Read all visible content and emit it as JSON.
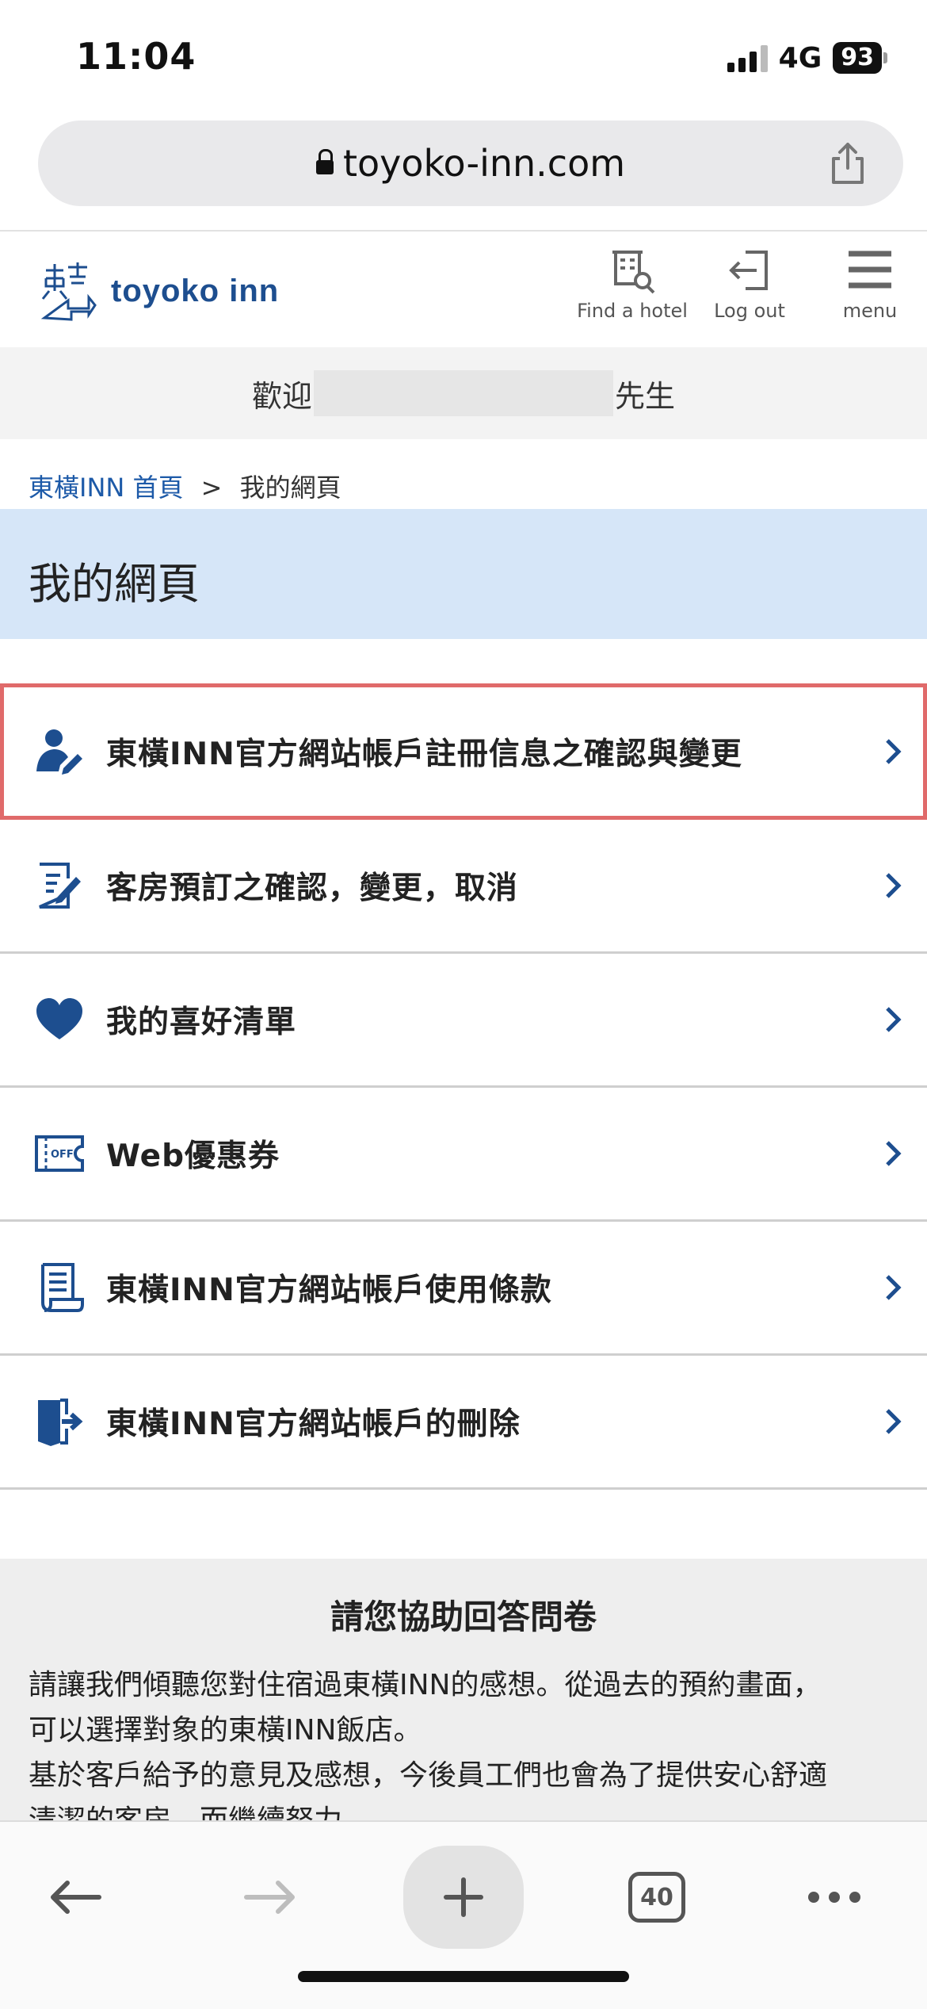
{
  "status_bar": {
    "time": "11:04",
    "network": "4G",
    "battery": "93"
  },
  "browser": {
    "url": "toyoko-inn.com",
    "tab_count": "40"
  },
  "site_header": {
    "brand": "toyoko inn",
    "nav": [
      {
        "label": "Find a hotel",
        "icon": "find-hotel-icon"
      },
      {
        "label": "Log out",
        "icon": "logout-icon"
      },
      {
        "label": "menu",
        "icon": "hamburger-icon"
      }
    ]
  },
  "welcome": {
    "prefix": "歡迎",
    "suffix": "先生"
  },
  "breadcrumb": {
    "home": "東橫INN 首頁",
    "separator": ">",
    "current": "我的網頁"
  },
  "page_title": "我的網頁",
  "menu_items": [
    {
      "label": "東橫INN官方網站帳戶註冊信息之確認與變更",
      "icon": "user-edit-icon",
      "highlighted": true
    },
    {
      "label": "客房預訂之確認，變更，取消",
      "icon": "document-edit-icon"
    },
    {
      "label": "我的喜好清單",
      "icon": "heart-icon"
    },
    {
      "label": "Web優惠券",
      "icon": "coupon-icon"
    },
    {
      "label": "東橫INN官方網站帳戶使用條款",
      "icon": "terms-icon"
    },
    {
      "label": "東橫INN官方網站帳戶的刪除",
      "icon": "exit-door-icon"
    }
  ],
  "survey": {
    "title": "請您協助回答問卷",
    "body_lines": [
      "請讓我們傾聽您對住宿過東橫INN的感想。從過去的預約畫面，",
      "可以選擇對象的東橫INN飯店。",
      "基於客戶給予的意見及感想，今後員工們也會為了提供安心舒適",
      "清潔的客房，而繼續努力。"
    ]
  },
  "colors": {
    "brand_blue": "#1d4e8f",
    "title_bg": "#d6e6f8",
    "highlight": "#e06a6a"
  }
}
